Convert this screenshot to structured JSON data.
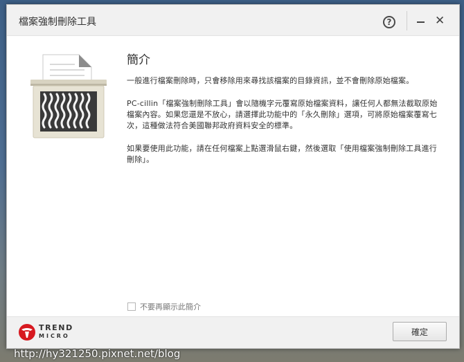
{
  "window": {
    "title": "檔案強制刪除工具"
  },
  "titlebar": {
    "help_glyph": "?",
    "close_glyph": "✕"
  },
  "content": {
    "heading": "簡介",
    "paragraphs": [
      "一般進行檔案刪除時，只會移除用來尋找該檔案的目錄資訊，並不會刪除原始檔案。",
      "PC-cillin「檔案強制刪除工具」會以隨機字元覆寫原始檔案資料，讓任何人都無法截取原始檔案內容。如果您還是不放心，請選擇此功能中的「永久刪除」選項，可將原始檔案覆寫七次，這種做法符合美國聯邦政府資料安全的標準。",
      "如果要使用此功能，請在任何檔案上點選滑鼠右鍵，然後選取「使用檔案強制刪除工具進行刪除」。"
    ]
  },
  "checkbox": {
    "label": "不要再顯示此簡介",
    "checked": false
  },
  "footer": {
    "logo_line1": "TREND",
    "logo_line2": "MICRO",
    "ok_label": "確定"
  },
  "watermark": "http://hy321250.pixnet.net/blog",
  "colors": {
    "logo_red": "#d71920",
    "shredder_body": "#e7e3d4",
    "shredder_slot": "#3a3a3a"
  },
  "icons": {
    "help": "question-circle-icon",
    "minimize": "minimize-icon",
    "close": "close-icon",
    "illustration": "paper-shredder-icon",
    "logo": "trend-micro-logo-icon"
  }
}
